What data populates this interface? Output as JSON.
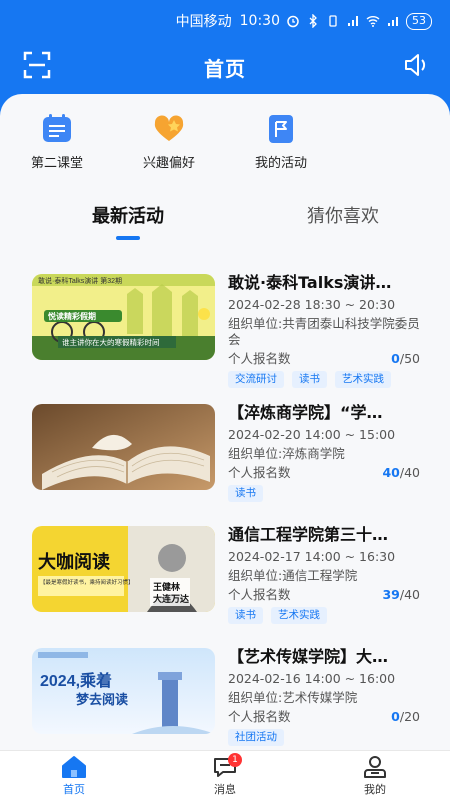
{
  "status_bar": {
    "carrier": "中国移动",
    "time": "10:30",
    "battery": "53"
  },
  "header": {
    "title": "首页"
  },
  "quick_links": [
    {
      "label": "第二课堂",
      "icon": "calendar-icon"
    },
    {
      "label": "兴趣偏好",
      "icon": "heart-star-icon"
    },
    {
      "label": "我的活动",
      "icon": "flag-icon"
    }
  ],
  "tabs": [
    {
      "label": "最新活动",
      "active": true
    },
    {
      "label": "猜你喜欢",
      "active": false
    }
  ],
  "activities": [
    {
      "title": "敢说·泰科Talks演讲…",
      "time": "2024-02-28 18:30 ~ 20:30",
      "org": "组织单位:共青团泰山科技学院委员会",
      "count_label": "个人报名数",
      "count": "0",
      "total": "/50",
      "tags": [
        "交流研讨",
        "读书",
        "艺术实践"
      ],
      "thumb_text": [
        "敢说·泰科Talks演讲 第32期",
        "悦读精彩假期",
        "谁主讲你在大的寒假精彩时间"
      ]
    },
    {
      "title": "【淬炼商学院】“学…",
      "time": "2024-02-20 14:00 ~ 15:00",
      "org": "组织单位:淬炼商学院",
      "count_label": "个人报名数",
      "count": "40",
      "total": "/40",
      "tags": [
        "读书"
      ],
      "thumb_text": []
    },
    {
      "title": "通信工程学院第三十…",
      "time": "2024-02-17 14:00 ~ 16:30",
      "org": "组织单位:通信工程学院",
      "count_label": "个人报名数",
      "count": "39",
      "total": "/40",
      "tags": [
        "读书",
        "艺术实践"
      ],
      "thumb_text": [
        "大咖阅读",
        "【最是寒假好读书，乘持阅读好习惯】",
        "王健林",
        "大连万达"
      ]
    },
    {
      "title": "【艺术传媒学院】大…",
      "time": "2024-02-16 14:00 ~ 16:00",
      "org": "组织单位:艺术传媒学院",
      "count_label": "个人报名数",
      "count": "0",
      "total": "/20",
      "tags": [
        "社团活动"
      ],
      "thumb_text": [
        "2024,乘着",
        "梦去阅读"
      ]
    }
  ],
  "bottom_nav": [
    {
      "label": "首页",
      "icon": "home-icon",
      "active": true
    },
    {
      "label": "消息",
      "icon": "message-icon",
      "badge": "1"
    },
    {
      "label": "我的",
      "icon": "user-icon"
    }
  ],
  "colors": {
    "primary": "#1677f2",
    "tag_bg": "#e6f0fe",
    "badge": "#ff3333"
  }
}
